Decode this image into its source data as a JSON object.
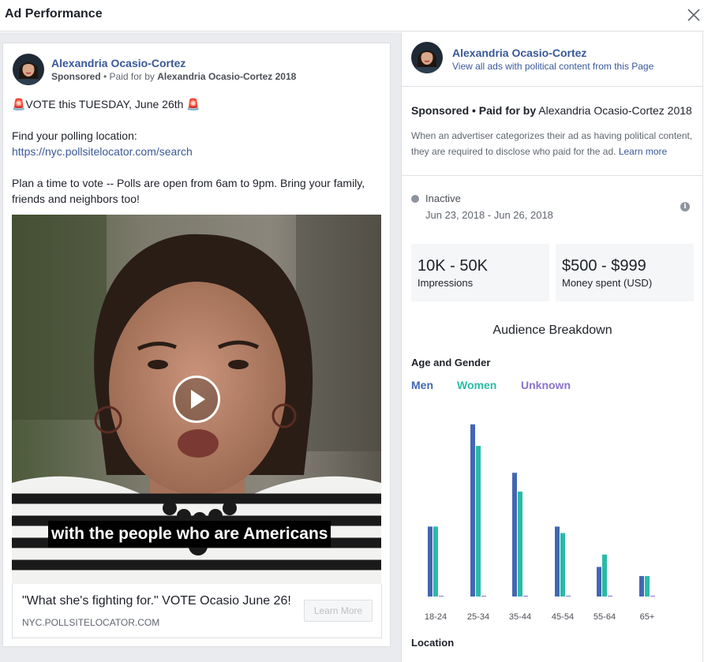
{
  "window": {
    "title": "Ad Performance"
  },
  "ad": {
    "page_name": "Alexandria Ocasio-Cortez",
    "sponsored_label": "Sponsored",
    "paid_for_prefix": " • Paid for by ",
    "paid_for_name": "Alexandria Ocasio-Cortez 2018",
    "line1": "🚨VOTE this TUESDAY, June 26th 🚨",
    "line2": "Find your polling location:",
    "link": "https://nyc.pollsitelocator.com/search",
    "line3": "Plan a time to vote -- Polls are open from 6am to 9pm. Bring your family, friends and neighbors too!",
    "video_caption": "with the people who are Americans",
    "cta_headline": "\"What she's fighting for.\" VOTE Ocasio June 26!",
    "cta_domain": "NYC.POLLSITELOCATOR.COM",
    "cta_button": "Learn More"
  },
  "details": {
    "page_name": "Alexandria Ocasio-Cortez",
    "view_all_link": "View all ads with political content from this Page",
    "disclaimer_bold": "Sponsored • Paid for by",
    "disclaimer_name": " Alexandria Ocasio-Cortez 2018",
    "disclaimer_text": "When an advertiser categorizes their ad as having political content, they are required to disclose who paid for the ad. ",
    "learn_more": "Learn more",
    "status": "Inactive",
    "dates": "Jun 23, 2018 - Jun 26, 2018",
    "impressions_value": "10K - 50K",
    "impressions_label": "Impressions",
    "spend_value": "$500 - $999",
    "spend_label": "Money spent (USD)",
    "audience_title": "Audience Breakdown",
    "age_gender_title": "Age and Gender",
    "location_title": "Location"
  },
  "colors": {
    "men": "#4267b2",
    "women": "#2abba7",
    "unknown": "#8c72cb",
    "link": "#385898",
    "dot_gray": "#8d949e"
  },
  "icons": {
    "close": "close-icon",
    "info": "info-icon",
    "play": "play-icon"
  },
  "chart_data": {
    "type": "bar",
    "categories": [
      "18-24",
      "25-34",
      "35-44",
      "45-54",
      "55-64",
      "65+"
    ],
    "series": [
      {
        "name": "Men",
        "values": [
          13,
          32,
          23,
          13,
          5.5,
          3.8
        ]
      },
      {
        "name": "Women",
        "values": [
          13,
          28,
          19.5,
          11.8,
          7.8,
          3.8
        ]
      },
      {
        "name": "Unknown",
        "values": [
          0.1,
          0.1,
          0.1,
          0.1,
          0.1,
          0.1
        ]
      }
    ],
    "title": "Age and Gender",
    "ylim": [
      0,
      33
    ],
    "grid": false,
    "legend": "top-left"
  }
}
